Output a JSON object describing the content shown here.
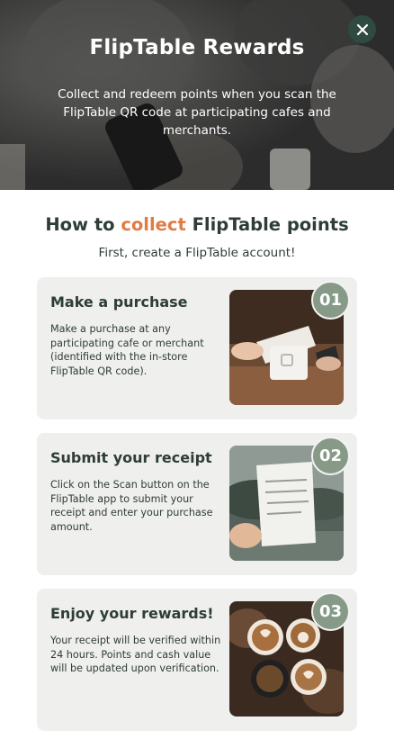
{
  "hero": {
    "title": "FlipTable Rewards",
    "description": "Collect and redeem points when you scan the FlipTable QR code at participating cafes and merchants.",
    "close_icon": "close-icon"
  },
  "section": {
    "title_prefix": "How to ",
    "title_accent": "collect",
    "title_suffix": " FlipTable points",
    "subtitle": "First, create a FlipTable account!",
    "accent_color": "#e07b45"
  },
  "steps": [
    {
      "number": "01",
      "title": "Make a purchase",
      "text": "Make a purchase at any participating cafe or merchant (identified with the in-store FlipTable QR code).",
      "image": "payment-terminal-photo"
    },
    {
      "number": "02",
      "title": "Submit your receipt",
      "text": "Click on the Scan button on the FlipTable app to submit your receipt and enter your purchase amount.",
      "image": "receipt-photo"
    },
    {
      "number": "03",
      "title": "Enjoy your rewards!",
      "text": "Your receipt will be verified within 24 hours. Points and cash value will be updated upon verification.",
      "image": "coffee-cups-photo"
    }
  ],
  "colors": {
    "brand_dark": "#2f4a41",
    "badge": "#879a87",
    "card_bg": "#efefee"
  }
}
